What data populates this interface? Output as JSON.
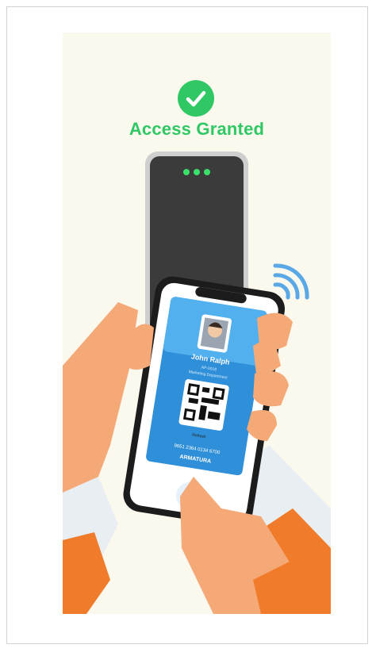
{
  "status": {
    "title": "Access Granted"
  },
  "card": {
    "name": "John Ralph",
    "id_line": "AP-0018",
    "department": "Marketing Department",
    "refresh_label": "Refresh",
    "card_number": "9651 2364 0134 6700",
    "brand": "ARMATURA"
  },
  "colors": {
    "success": "#2fc864",
    "card_blue": "#2f8fd8",
    "reader": "#3b3b3b",
    "skin": "#f4a977",
    "sleeve": "#f07c2b"
  }
}
